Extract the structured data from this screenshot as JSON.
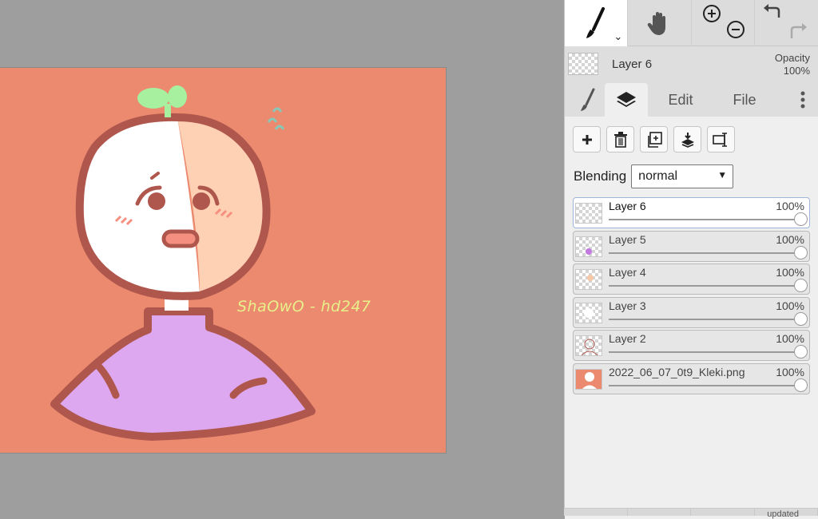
{
  "header": {
    "layer_name": "Layer 6",
    "opacity_label": "Opacity",
    "opacity_value": "100%"
  },
  "tabs": [
    {
      "label": ""
    },
    {
      "label": ""
    },
    {
      "label": "Edit"
    },
    {
      "label": "File"
    }
  ],
  "blending": {
    "label": "Blending",
    "value": "normal"
  },
  "layers": [
    {
      "name": "Layer 6",
      "opacity": "100%"
    },
    {
      "name": "Layer 5",
      "opacity": "100%"
    },
    {
      "name": "Layer 4",
      "opacity": "100%"
    },
    {
      "name": "Layer 3",
      "opacity": "100%"
    },
    {
      "name": "Layer 2",
      "opacity": "100%"
    },
    {
      "name": "2022_06_07_0t9_Kleki.png",
      "opacity": "100%"
    }
  ],
  "canvas": {
    "signature": "ShaOwO - hd247"
  },
  "status": {
    "text": "updated"
  },
  "colors": {
    "background": "#eb8a6f",
    "shirt": "#dda8f0",
    "outline": "#b0574d",
    "sprout": "#a6f0a0"
  }
}
